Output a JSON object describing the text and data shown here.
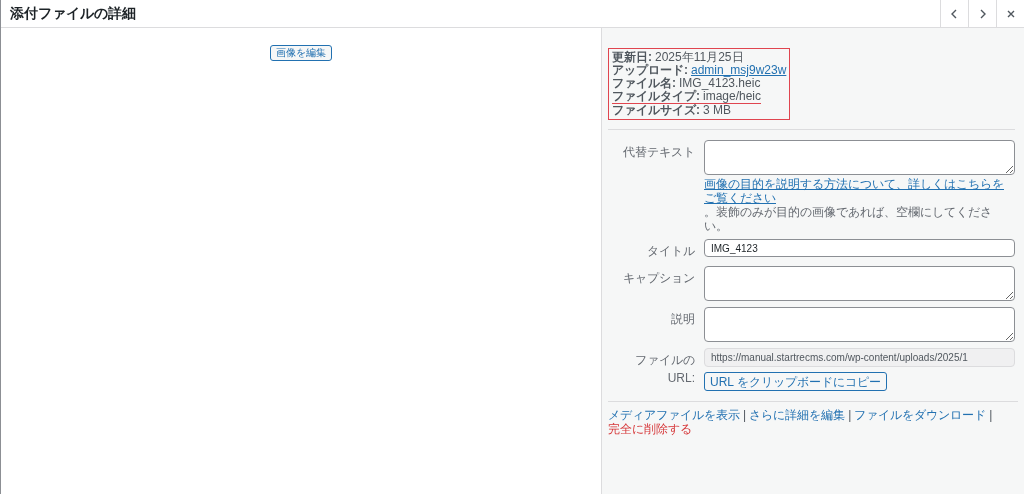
{
  "window": {
    "title": "添付ファイルの詳細",
    "nav": [
      {
        "kind": "prev"
      },
      {
        "kind": "next"
      },
      {
        "kind": "close"
      }
    ]
  },
  "preview": {
    "edit_button": "画像を編集"
  },
  "info": {
    "highlighted": true,
    "rows": [
      {
        "label": "更新日:",
        "value": "2025年11月25日",
        "link": false,
        "underlined": false
      },
      {
        "label": "アップロード:",
        "value": "admin_msj9w23w",
        "link": true,
        "underlined": false
      },
      {
        "label": "ファイル名:",
        "value": "IMG_4123.heic",
        "link": false,
        "underlined": false
      },
      {
        "label": "ファイルタイプ:",
        "value": "image/heic",
        "link": false,
        "underlined": true
      },
      {
        "label": "ファイルサイズ:",
        "value": "3 MB",
        "link": false,
        "underlined": false
      }
    ]
  },
  "fields": [
    {
      "kind": "textarea",
      "label": "代替テキスト",
      "help_link": "画像の目的を説明する方法について、詳しくはこちらをご覧ください",
      "help_text": "。装飾のみが目的の画像であれば、空欄にしてください。"
    },
    {
      "kind": "text",
      "label": "タイトル",
      "value": "IMG_4123"
    },
    {
      "kind": "textarea",
      "label": "キャプション"
    },
    {
      "kind": "textarea",
      "label": "説明"
    },
    {
      "kind": "url",
      "label": "ファイルの URL:",
      "value": "https://manual.startrecms.com/wp-content/uploads/2025/1",
      "button": "URL をクリップボードにコピー"
    }
  ],
  "actions": [
    {
      "kind": "link",
      "label": "メディアファイルを表示",
      "danger": false
    },
    {
      "kind": "separator",
      "label": "|"
    },
    {
      "kind": "link",
      "label": "さらに詳細を編集",
      "danger": false
    },
    {
      "kind": "separator",
      "label": "|"
    },
    {
      "kind": "link",
      "label": "ファイルをダウンロード",
      "danger": false
    },
    {
      "kind": "separator",
      "label": "|"
    },
    {
      "kind": "link",
      "label": "完全に削除する",
      "danger": true
    }
  ]
}
